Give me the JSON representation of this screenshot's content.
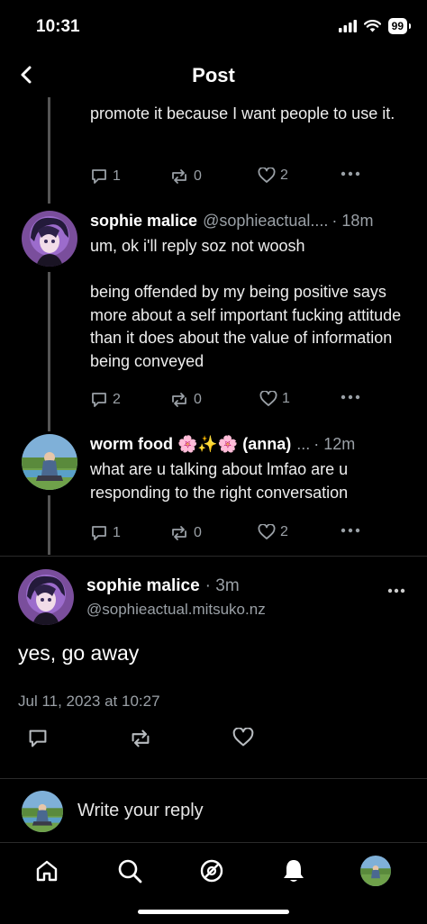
{
  "status_bar": {
    "time": "10:31",
    "battery": "99"
  },
  "header": {
    "title": "Post"
  },
  "thread": [
    {
      "text_fragment": "promote it because I want people to use it.",
      "replies": "1",
      "reposts": "0",
      "likes": "2"
    },
    {
      "name": "sophie malice",
      "handle": "@sophieactual....",
      "time": "· 18m",
      "text": "um, ok i'll reply soz not woosh\n\nbeing offended by my being positive says more about a self important fucking attitude than it does about the value of information being conveyed",
      "replies": "2",
      "reposts": "0",
      "likes": "1"
    },
    {
      "name": "worm food 🌸✨🌸 (anna)",
      "handle": "...",
      "time": "· 12m",
      "text": "what are u talking about lmfao are u responding to the right conversation",
      "replies": "1",
      "reposts": "0",
      "likes": "2"
    }
  ],
  "main_post": {
    "name": "sophie malice",
    "time": "· 3m",
    "handle": "@sophieactual.mitsuko.nz",
    "text": "yes, go away",
    "date": "Jul 11, 2023 at 10:27"
  },
  "reply_bar": {
    "placeholder": "Write your reply"
  },
  "nav": [
    "home-icon",
    "search-icon",
    "feeds-icon",
    "notifications-icon",
    "profile-avatar"
  ],
  "colors": {
    "background": "#000000",
    "muted": "#9aa0a6",
    "thread_line": "#555555"
  }
}
